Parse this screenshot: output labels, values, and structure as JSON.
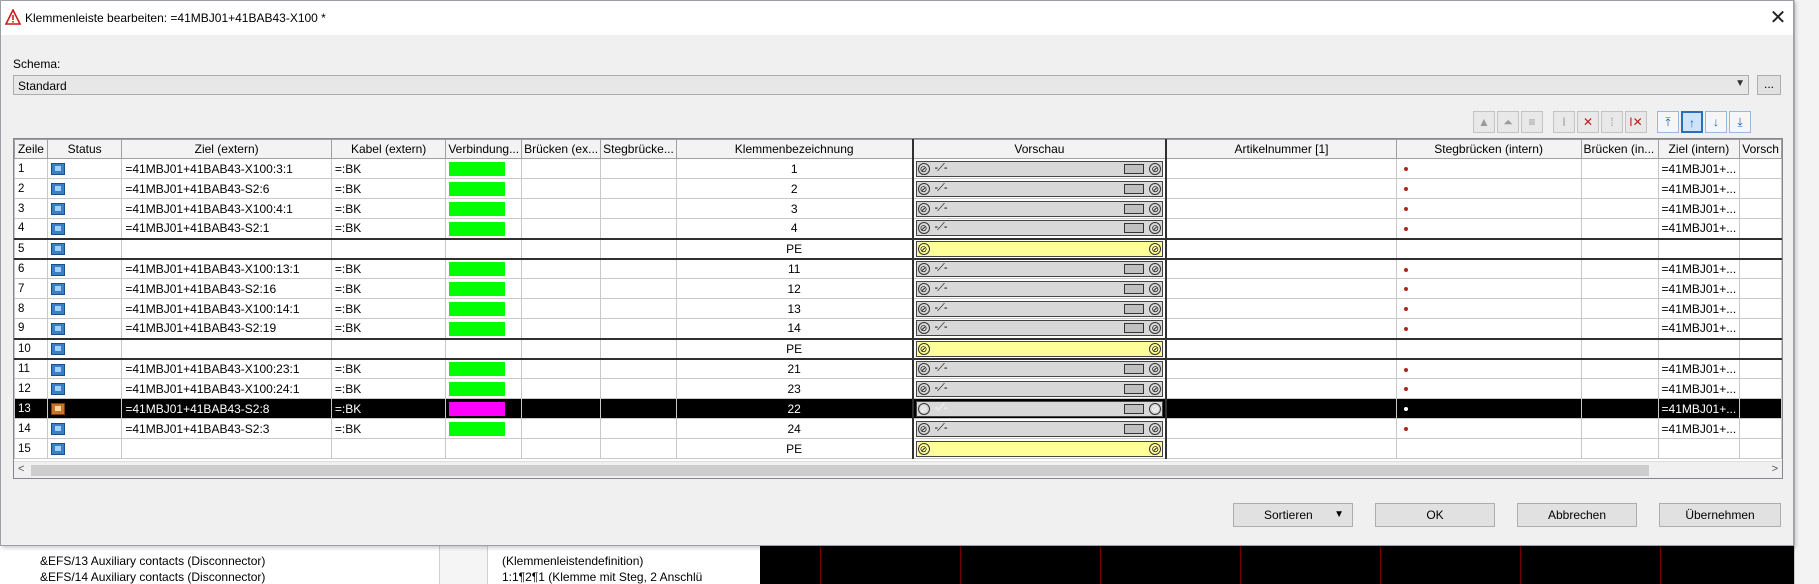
{
  "window": {
    "title": "Klemmenleiste bearbeiten: =41MBJ01+41BAB43-X100 *",
    "close_symbol": "✕"
  },
  "schema": {
    "label": "Schema:",
    "value": "Standard",
    "more_button": "..."
  },
  "toolbar_icons": [
    "move-top-icon",
    "move-up-icon",
    "align-icon",
    "insert-bridge-icon",
    "delete-bridge-icon",
    "bridge-vertical-icon",
    "delete-bridge-2-icon",
    "scroll-top-icon",
    "scroll-up-icon",
    "scroll-down-icon",
    "scroll-bottom-icon"
  ],
  "table": {
    "headers": [
      "Zeile",
      "Status",
      "Ziel (extern)",
      "Kabel (extern)",
      "Verbindung...",
      "Brücken (ex...",
      "Stegbrücke...",
      "Klemmenbezeichnung",
      "Vorschau",
      "Artikelnummer [1]",
      "Stegbrücken (intern)",
      "Brücken (in...",
      "Ziel (intern)",
      "Vorsch"
    ],
    "rows": [
      {
        "zeile": "1",
        "status": "ok",
        "ziel": "=41MBJ01+41BAB43-X100:3:1",
        "kabel": "=:BK",
        "verb_color": "#00ff00",
        "klemme": "1",
        "vorschau": "normal",
        "steg": true,
        "ziel_intern": "=41MBJ01+..."
      },
      {
        "zeile": "2",
        "status": "ok",
        "ziel": "=41MBJ01+41BAB43-S2:6",
        "kabel": "=:BK",
        "verb_color": "#00ff00",
        "klemme": "2",
        "vorschau": "normal",
        "steg": true,
        "ziel_intern": "=41MBJ01+..."
      },
      {
        "zeile": "3",
        "status": "ok",
        "ziel": "=41MBJ01+41BAB43-X100:4:1",
        "kabel": "=:BK",
        "verb_color": "#00ff00",
        "klemme": "3",
        "vorschau": "normal",
        "steg": true,
        "ziel_intern": "=41MBJ01+..."
      },
      {
        "zeile": "4",
        "status": "ok",
        "ziel": "=41MBJ01+41BAB43-S2:1",
        "kabel": "=:BK",
        "verb_color": "#00ff00",
        "klemme": "4",
        "vorschau": "normal",
        "steg": true,
        "ziel_intern": "=41MBJ01+..."
      },
      {
        "zeile": "5",
        "status": "ok",
        "ziel": "",
        "kabel": "",
        "verb_color": "",
        "klemme": "PE",
        "vorschau": "pe",
        "steg": false,
        "ziel_intern": ""
      },
      {
        "zeile": "6",
        "status": "ok",
        "ziel": "=41MBJ01+41BAB43-X100:13:1",
        "kabel": "=:BK",
        "verb_color": "#00ff00",
        "klemme": "11",
        "vorschau": "normal",
        "steg": true,
        "ziel_intern": "=41MBJ01+..."
      },
      {
        "zeile": "7",
        "status": "ok",
        "ziel": "=41MBJ01+41BAB43-S2:16",
        "kabel": "=:BK",
        "verb_color": "#00ff00",
        "klemme": "12",
        "vorschau": "normal",
        "steg": true,
        "ziel_intern": "=41MBJ01+..."
      },
      {
        "zeile": "8",
        "status": "ok",
        "ziel": "=41MBJ01+41BAB43-X100:14:1",
        "kabel": "=:BK",
        "verb_color": "#00ff00",
        "klemme": "13",
        "vorschau": "normal",
        "steg": true,
        "ziel_intern": "=41MBJ01+..."
      },
      {
        "zeile": "9",
        "status": "ok",
        "ziel": "=41MBJ01+41BAB43-S2:19",
        "kabel": "=:BK",
        "verb_color": "#00ff00",
        "klemme": "14",
        "vorschau": "normal",
        "steg": true,
        "ziel_intern": "=41MBJ01+..."
      },
      {
        "zeile": "10",
        "status": "ok",
        "ziel": "",
        "kabel": "",
        "verb_color": "",
        "klemme": "PE",
        "vorschau": "pe",
        "steg": false,
        "ziel_intern": ""
      },
      {
        "zeile": "11",
        "status": "ok",
        "ziel": "=41MBJ01+41BAB43-X100:23:1",
        "kabel": "=:BK",
        "verb_color": "#00ff00",
        "klemme": "21",
        "vorschau": "normal",
        "steg": true,
        "ziel_intern": "=41MBJ01+..."
      },
      {
        "zeile": "12",
        "status": "ok",
        "ziel": "=41MBJ01+41BAB43-X100:24:1",
        "kabel": "=:BK",
        "verb_color": "#00ff00",
        "klemme": "23",
        "vorschau": "normal",
        "steg": true,
        "ziel_intern": "=41MBJ01+..."
      },
      {
        "zeile": "13",
        "status": "warn",
        "ziel": "=41MBJ01+41BAB43-S2:8",
        "kabel": "=:BK",
        "verb_color": "#ff00ff",
        "klemme": "22",
        "vorschau": "normal",
        "steg": true,
        "ziel_intern": "=41MBJ01+...",
        "selected": true
      },
      {
        "zeile": "14",
        "status": "ok",
        "ziel": "=41MBJ01+41BAB43-S2:3",
        "kabel": "=:BK",
        "verb_color": "#00ff00",
        "klemme": "24",
        "vorschau": "normal",
        "steg": true,
        "ziel_intern": "=41MBJ01+..."
      },
      {
        "zeile": "15",
        "status": "ok",
        "ziel": "",
        "kabel": "",
        "verb_color": "",
        "klemme": "PE",
        "vorschau": "pe",
        "steg": false,
        "ziel_intern": ""
      }
    ]
  },
  "buttons": {
    "sort": "Sortieren",
    "ok": "OK",
    "cancel": "Abbrechen",
    "apply": "Übernehmen"
  },
  "background": {
    "tree_left": [
      "&EFS/13 Auxiliary contacts (Disconnector)",
      "&EFS/14 Auxiliary contacts (Disconnector)"
    ],
    "tree_right": [
      "(Klemmenleistendefinition)",
      "1:1¶2¶1 (Klemme mit Steg, 2 Anschlü"
    ]
  }
}
